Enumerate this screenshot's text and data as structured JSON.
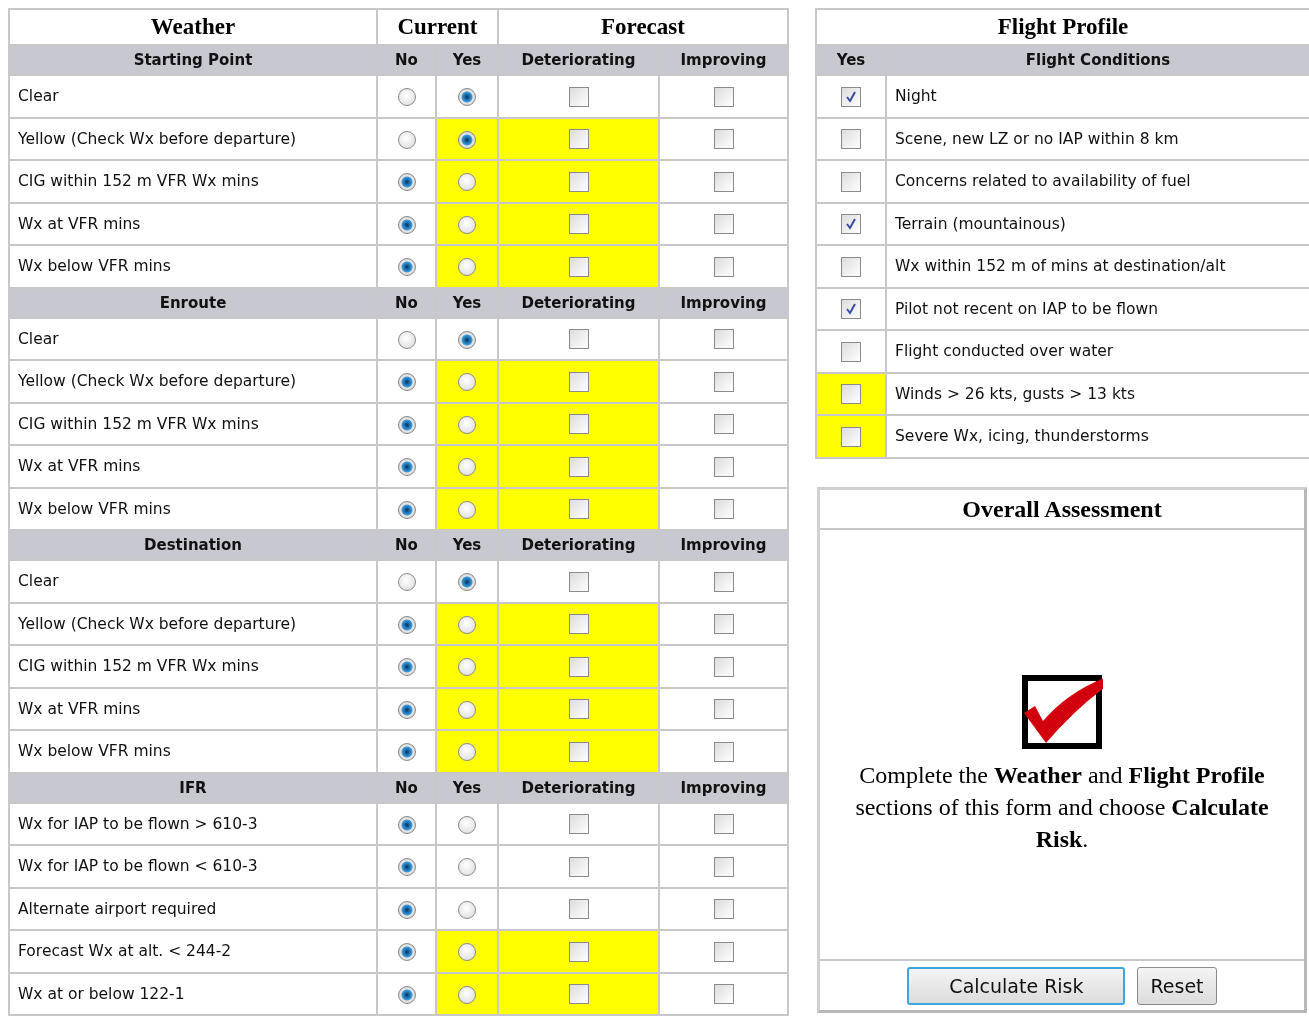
{
  "weather": {
    "columns": [
      "Weather",
      "Current",
      "Forecast"
    ],
    "sections": [
      {
        "name": "Starting Point",
        "columns": [
          "No",
          "Yes",
          "Deteriorating",
          "Improving"
        ],
        "rows": [
          {
            "label": "Clear",
            "no_selected": false,
            "yes_selected": true,
            "highlight": false,
            "deteriorating": false,
            "improving": false
          },
          {
            "label": "Yellow (Check Wx before departure)",
            "no_selected": false,
            "yes_selected": true,
            "highlight": true,
            "deteriorating": false,
            "improving": false
          },
          {
            "label": "CIG within 152 m VFR Wx mins",
            "no_selected": true,
            "yes_selected": false,
            "highlight": true,
            "deteriorating": false,
            "improving": false
          },
          {
            "label": "Wx at VFR mins",
            "no_selected": true,
            "yes_selected": false,
            "highlight": true,
            "deteriorating": false,
            "improving": false
          },
          {
            "label": "Wx below VFR mins",
            "no_selected": true,
            "yes_selected": false,
            "highlight": true,
            "deteriorating": false,
            "improving": false
          }
        ]
      },
      {
        "name": "Enroute",
        "columns": [
          "No",
          "Yes",
          "Deteriorating",
          "Improving"
        ],
        "rows": [
          {
            "label": "Clear",
            "no_selected": false,
            "yes_selected": true,
            "highlight": false,
            "deteriorating": false,
            "improving": false
          },
          {
            "label": "Yellow (Check Wx before departure)",
            "no_selected": true,
            "yes_selected": false,
            "highlight": true,
            "deteriorating": false,
            "improving": false
          },
          {
            "label": "CIG within 152 m VFR Wx mins",
            "no_selected": true,
            "yes_selected": false,
            "highlight": true,
            "deteriorating": false,
            "improving": false
          },
          {
            "label": "Wx at VFR mins",
            "no_selected": true,
            "yes_selected": false,
            "highlight": true,
            "deteriorating": false,
            "improving": false
          },
          {
            "label": "Wx below VFR mins",
            "no_selected": true,
            "yes_selected": false,
            "highlight": true,
            "deteriorating": false,
            "improving": false
          }
        ]
      },
      {
        "name": "Destination",
        "columns": [
          "No",
          "Yes",
          "Deteriorating",
          "Improving"
        ],
        "rows": [
          {
            "label": "Clear",
            "no_selected": false,
            "yes_selected": true,
            "highlight": false,
            "deteriorating": false,
            "improving": false
          },
          {
            "label": "Yellow (Check Wx before departure)",
            "no_selected": true,
            "yes_selected": false,
            "highlight": true,
            "deteriorating": false,
            "improving": false
          },
          {
            "label": "CIG within 152 m VFR Wx mins",
            "no_selected": true,
            "yes_selected": false,
            "highlight": true,
            "deteriorating": false,
            "improving": false
          },
          {
            "label": "Wx at VFR mins",
            "no_selected": true,
            "yes_selected": false,
            "highlight": true,
            "deteriorating": false,
            "improving": false
          },
          {
            "label": "Wx below VFR mins",
            "no_selected": true,
            "yes_selected": false,
            "highlight": true,
            "deteriorating": false,
            "improving": false
          }
        ]
      },
      {
        "name": "IFR",
        "columns": [
          "No",
          "Yes",
          "Deteriorating",
          "Improving"
        ],
        "rows": [
          {
            "label": "Wx for IAP to be flown > 610-3",
            "no_selected": true,
            "yes_selected": false,
            "highlight": false,
            "deteriorating": false,
            "improving": false
          },
          {
            "label": "Wx for IAP to be flown < 610-3",
            "no_selected": true,
            "yes_selected": false,
            "highlight": false,
            "deteriorating": false,
            "improving": false
          },
          {
            "label": "Alternate airport required",
            "no_selected": true,
            "yes_selected": false,
            "highlight": false,
            "deteriorating": false,
            "improving": false
          },
          {
            "label": "Forecast Wx at alt. < 244-2",
            "no_selected": true,
            "yes_selected": false,
            "highlight": true,
            "deteriorating": false,
            "improving": false
          },
          {
            "label": "Wx at or below 122-1",
            "no_selected": true,
            "yes_selected": false,
            "highlight": true,
            "deteriorating": false,
            "improving": false
          }
        ]
      }
    ]
  },
  "flight_profile": {
    "title": "Flight Profile",
    "columns": [
      "Yes",
      "Flight Conditions"
    ],
    "items": [
      {
        "label": "Night",
        "checked": true,
        "highlight": false
      },
      {
        "label": "Scene, new LZ or no IAP within 8 km",
        "checked": false,
        "highlight": false
      },
      {
        "label": "Concerns related to availability of fuel",
        "checked": false,
        "highlight": false
      },
      {
        "label": "Terrain (mountainous)",
        "checked": true,
        "highlight": false
      },
      {
        "label": "Wx within 152 m of mins at destination/alt",
        "checked": false,
        "highlight": false
      },
      {
        "label": "Pilot not recent on IAP to be flown",
        "checked": true,
        "highlight": false
      },
      {
        "label": "Flight conducted over water",
        "checked": false,
        "highlight": false
      },
      {
        "label": "Winds > 26 kts, gusts > 13 kts",
        "checked": false,
        "highlight": true
      },
      {
        "label": "Severe Wx, icing, thunderstorms",
        "checked": false,
        "highlight": true
      }
    ]
  },
  "assessment": {
    "title": "Overall Assessment",
    "message": "Complete the **Weather** and **Flight Profile** sections of this form and choose **Calculate Risk**.",
    "buttons": [
      {
        "label": "Calculate Risk",
        "default": true
      },
      {
        "label": "Reset",
        "default": false
      }
    ]
  }
}
